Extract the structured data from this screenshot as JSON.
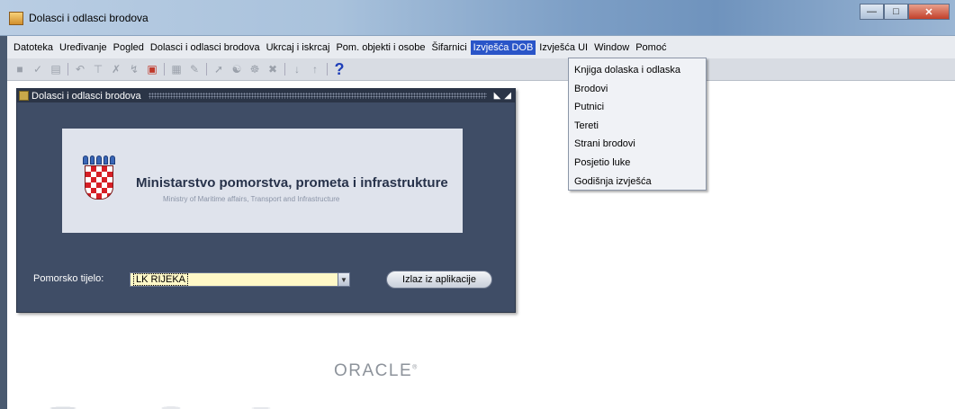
{
  "window": {
    "title": "Dolasci i odlasci brodova",
    "app_icon": "forms-app-icon",
    "controls": [
      "minimize",
      "maximize",
      "close"
    ]
  },
  "menubar": {
    "items": [
      {
        "label": "Datoteka"
      },
      {
        "label": "Uređivanje"
      },
      {
        "label": "Pogled"
      },
      {
        "label": "Dolasci i odlasci brodova"
      },
      {
        "label": "Ukrcaj i iskrcaj"
      },
      {
        "label": "Pom. objekti i osobe"
      },
      {
        "label": "Šifarnici"
      },
      {
        "label": "Izvješća DOB",
        "active": true
      },
      {
        "label": "Izvješća UI"
      },
      {
        "label": "Window"
      },
      {
        "label": "Pomoć"
      }
    ]
  },
  "toolbar": {
    "icons": [
      "save-icon",
      "accept-icon",
      "print-icon",
      "undo-icon",
      "filter-icon",
      "clear-filter-icon",
      "query-icon",
      "execute-query-icon",
      "table-icon",
      "edit-icon",
      "insert-record-icon",
      "duplicate-icon",
      "lov-icon",
      "delete-record-icon",
      "next-icon",
      "previous-icon",
      "help-icon"
    ],
    "help_glyph": "?"
  },
  "dropdown": {
    "items": [
      "Knjiga dolaska i odlaska",
      "Brodovi",
      "Putnici",
      "Tereti",
      "Strani brodovi",
      "Posjetio luke",
      "Godišnja izvješća"
    ]
  },
  "inner_window": {
    "title": "Dolasci i odlasci brodova",
    "ministry_name": "Ministarstvo pomorstva, prometa i infrastrukture",
    "ministry_name_en": "Ministry of Maritime affairs, Transport and Infrastructure",
    "field_label": "Pomorsko tijelo:",
    "field_value": "LK RIJEKA",
    "exit_button": "Izlaz iz aplikacije"
  },
  "footer": {
    "logo_text": "ORACLE",
    "trademark": "®"
  },
  "colors": {
    "menu_highlight": "#2a55c8",
    "inner_window_bg": "#3f4d66",
    "select_bg": "#fff8c7"
  }
}
